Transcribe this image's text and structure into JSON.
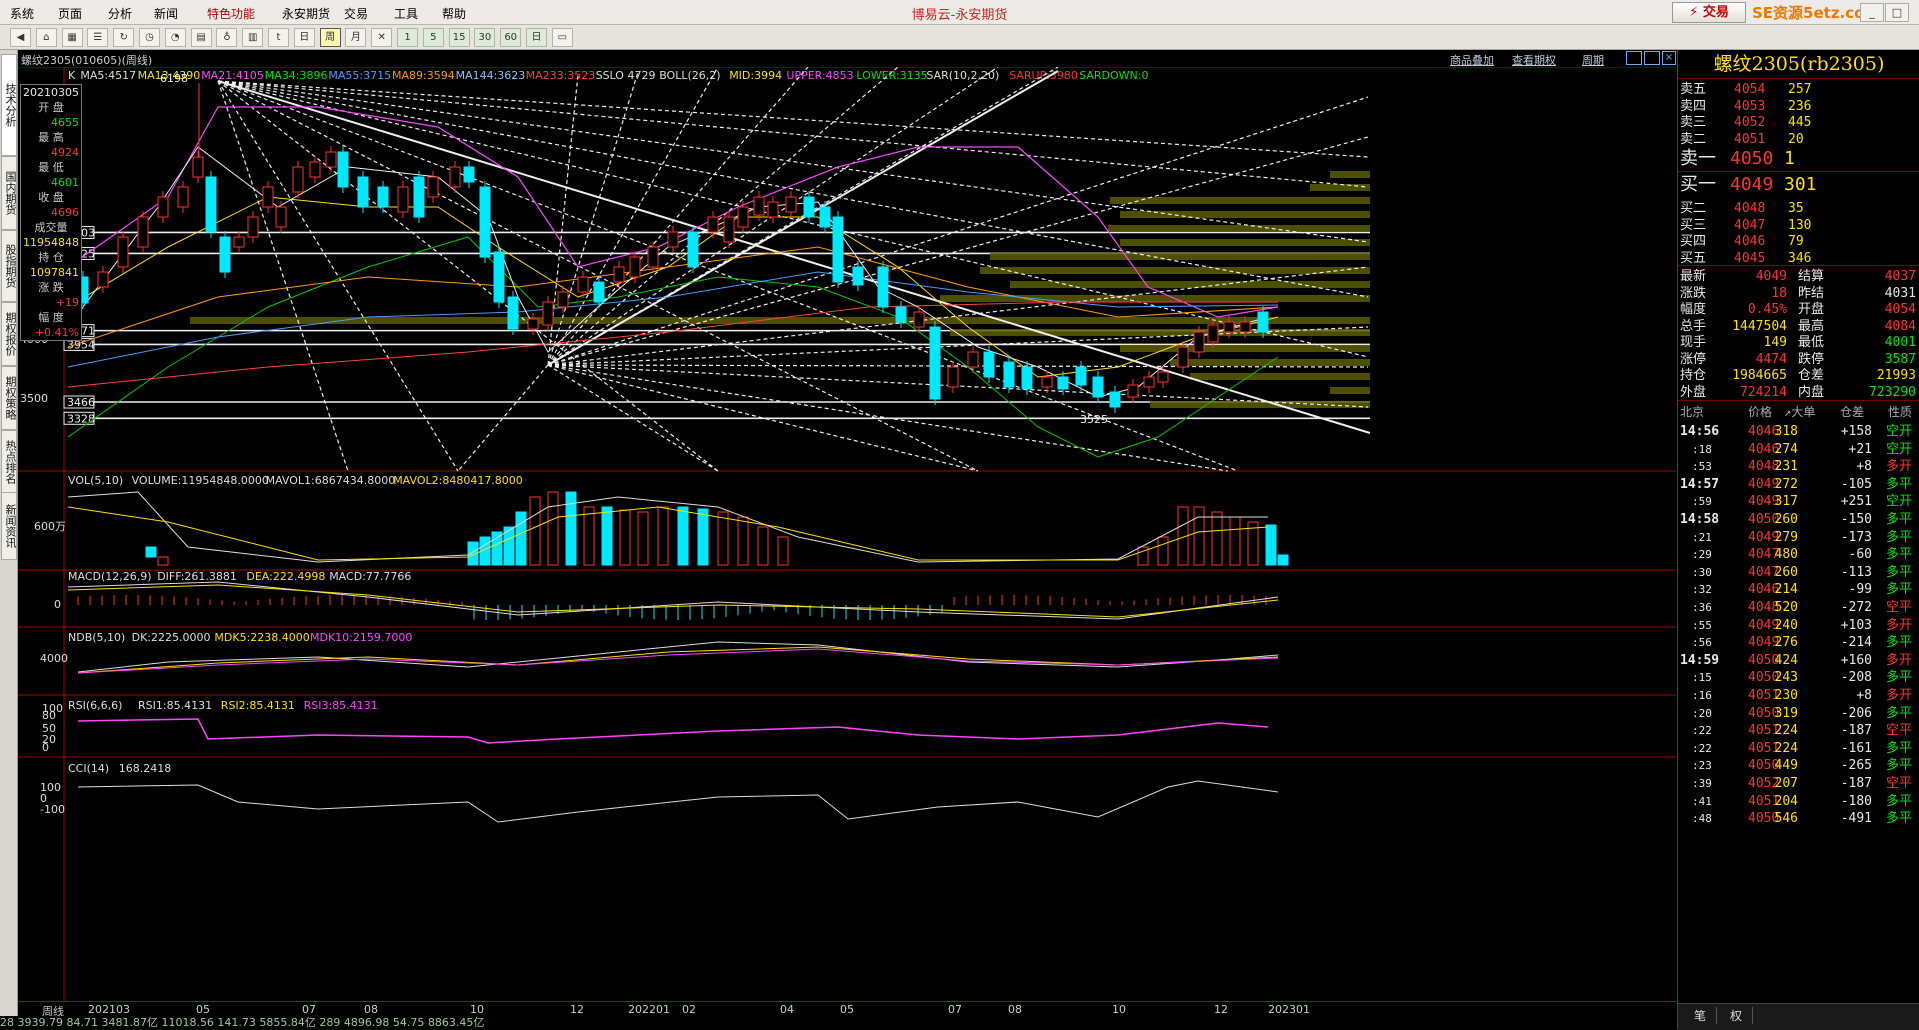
{
  "menu": {
    "items": [
      "系统",
      "页面",
      "分析",
      "新闻",
      "特色功能",
      "永安期货",
      "交易",
      "工具",
      "帮助"
    ],
    "highlight_index": 4,
    "app_title": "博易云-永安期货",
    "trade_button": "交易",
    "brand_watermark": "SE资源5etz.com"
  },
  "toolbar": {
    "period_buttons": [
      "1",
      "5",
      "15",
      "30",
      "60",
      "日"
    ],
    "icons": [
      "back-icon",
      "home-icon",
      "grid-icon",
      "list-icon",
      "refresh-icon",
      "clock-icon",
      "pie-icon",
      "chart-icon",
      "cup-icon",
      "bar-icon",
      "tick-icon",
      "day-icon",
      "week-icon",
      "month-icon",
      "x-icon",
      "num1",
      "num5",
      "num15",
      "num30",
      "num60",
      "day2",
      "print-icon"
    ]
  },
  "left_tabs": [
    "技术分析",
    "国内期货",
    "股指期货",
    "期权报价",
    "期权策略",
    "热点排名",
    "新闻资讯"
  ],
  "chart": {
    "symbol": "螺纹2305(010605)(周线)",
    "links": [
      "商品叠加",
      "查看期权",
      "周期"
    ],
    "ma_legend": [
      {
        "text": "K",
        "color": "#dddddd"
      },
      {
        "text": "MA5:4517",
        "color": "#dddddd"
      },
      {
        "text": "MA13:4390",
        "color": "#ffe000"
      },
      {
        "text": "MA21:4105",
        "color": "#ff44ff"
      },
      {
        "text": "MA34:3896",
        "color": "#00e600"
      },
      {
        "text": "MA55:3715",
        "color": "#4a9cff"
      },
      {
        "text": "MA89:3594",
        "color": "#ff9a00"
      },
      {
        "text": "MA144:3623",
        "color": "#7fc7ff"
      },
      {
        "text": "MA233:3523",
        "color": "#ff4040"
      },
      {
        "text": "SSLO 4729",
        "color": "#dddddd"
      },
      {
        "text": "BOLL(26,2)",
        "color": "#dddddd"
      },
      {
        "text": "MID:3994",
        "color": "#ffe000"
      },
      {
        "text": "UPPER:4853",
        "color": "#ff44ff"
      },
      {
        "text": "LOWER:3135",
        "color": "#00e600"
      },
      {
        "text": "SAR(10,2,20)",
        "color": "#dddddd"
      },
      {
        "text": "SARUP:3980",
        "color": "#ff3030"
      },
      {
        "text": "SARDOWN:0",
        "color": "#00e600"
      }
    ],
    "y_labels": [
      "4500",
      "4000",
      "3500"
    ],
    "y_boxes": [
      "4903",
      "4725",
      "4071",
      "3954",
      "3466",
      "3328"
    ],
    "peak_label": "6198",
    "low_label": "3525",
    "info": {
      "date": "20210305",
      "open_label": "开 盘",
      "open": "4655",
      "high_label": "最 高",
      "high": "4924",
      "low_label": "最 低",
      "low": "4601",
      "close_label": "收 盘",
      "close": "4696",
      "vol_label": "成交量",
      "vol": "11954848",
      "oi_label": "持 仓",
      "oi": "1097841",
      "chg_label": "涨 跌",
      "chg": "+19",
      "pct_label": "幅 度",
      "pct": "+0.41%"
    },
    "vol_legend": [
      {
        "text": "VOL(5,10)",
        "color": "#dddddd"
      },
      {
        "text": "VOLUME:11954848.0000",
        "color": "#dddddd"
      },
      {
        "text": "MAVOL1:6867434.8000",
        "color": "#dddddd"
      },
      {
        "text": "MAVOL2:8480417.8000",
        "color": "#ffe000"
      }
    ],
    "vol_y": "600万",
    "macd_legend": [
      {
        "text": "MACD(12,26,9)",
        "color": "#dddddd"
      },
      {
        "text": "DIFF:261.3881",
        "color": "#dddddd"
      },
      {
        "text": "DEA:222.4998",
        "color": "#ffe000"
      },
      {
        "text": "MACD:77.7766",
        "color": "#dddddd"
      }
    ],
    "macd_y": "0",
    "ndb_legend": [
      {
        "text": "NDB(5,10)",
        "color": "#dddddd"
      },
      {
        "text": "DK:2225.0000",
        "color": "#dddddd"
      },
      {
        "text": "MDK5:2238.4000",
        "color": "#ffe000"
      },
      {
        "text": "MDK10:2159.7000",
        "color": "#ff44ff"
      }
    ],
    "ndb_y": "4000",
    "rsi_legend": [
      {
        "text": "RSI(6,6,6)",
        "color": "#dddddd"
      },
      {
        "text": "RSI1:85.4131",
        "color": "#dddddd"
      },
      {
        "text": "RSI2:85.4131",
        "color": "#ffe000"
      },
      {
        "text": "RSI3:85.4131",
        "color": "#ff44ff"
      }
    ],
    "rsi_y": [
      "100",
      "80",
      "50",
      "20",
      "0"
    ],
    "cci_legend": [
      {
        "text": "CCI(14)",
        "color": "#dddddd"
      },
      {
        "text": "168.2418",
        "color": "#dddddd"
      }
    ],
    "cci_y": [
      "100",
      "0",
      "-100"
    ],
    "x_axis_label": "周线",
    "x_labels": [
      "202103",
      "05",
      "07",
      "08",
      "10",
      "12",
      "202201",
      "02",
      "04",
      "05",
      "07",
      "08",
      "10",
      "12",
      "202301"
    ],
    "status_text": "28  3939.79  84.71  3481.87亿  11018.56  141.73  5855.84亿  289  4896.98  54.75  8863.45亿"
  },
  "quote": {
    "title": "螺纹2305(rb2305)",
    "asks": [
      {
        "label": "卖五",
        "price": "4054",
        "vol": "257"
      },
      {
        "label": "卖四",
        "price": "4053",
        "vol": "236"
      },
      {
        "label": "卖三",
        "price": "4052",
        "vol": "445"
      },
      {
        "label": "卖二",
        "price": "4051",
        "vol": "20"
      },
      {
        "label": "卖一",
        "price": "4050",
        "vol": "1"
      }
    ],
    "bids": [
      {
        "label": "买一",
        "price": "4049",
        "vol": "301"
      },
      {
        "label": "买二",
        "price": "4048",
        "vol": "35"
      },
      {
        "label": "买三",
        "price": "4047",
        "vol": "130"
      },
      {
        "label": "买四",
        "price": "4046",
        "vol": "79"
      },
      {
        "label": "买五",
        "price": "4045",
        "vol": "346"
      }
    ],
    "stats": [
      {
        "l1": "最新",
        "v1": "4049",
        "c1": "red",
        "l2": "结算",
        "v2": "4037",
        "c2": "red"
      },
      {
        "l1": "涨跌",
        "v1": "18",
        "c1": "red",
        "l2": "昨结",
        "v2": "4031",
        "c2": "wht"
      },
      {
        "l1": "幅度",
        "v1": "0.45%",
        "c1": "red",
        "l2": "开盘",
        "v2": "4054",
        "c2": "red"
      },
      {
        "l1": "总手",
        "v1": "1447504",
        "c1": "yel",
        "l2": "最高",
        "v2": "4084",
        "c2": "red"
      },
      {
        "l1": "现手",
        "v1": "149",
        "c1": "yel",
        "l2": "最低",
        "v2": "4001",
        "c2": "green"
      },
      {
        "l1": "涨停",
        "v1": "4474",
        "c1": "red",
        "l2": "跌停",
        "v2": "3587",
        "c2": "green"
      },
      {
        "l1": "持仓",
        "v1": "1984665",
        "c1": "yel",
        "l2": "仓差",
        "v2": "21993",
        "c2": "yel"
      },
      {
        "l1": "外盘",
        "v1": "724214",
        "c1": "red",
        "l2": "内盘",
        "v2": "723290",
        "c2": "green"
      }
    ],
    "tick_header": {
      "time": "北京",
      "price": "价格",
      "vol": "↗大单",
      "diff": "仓差",
      "nature": "性质"
    },
    "ticks": [
      {
        "time": "14:56",
        "price": "4046",
        "pc": "red",
        "vol": "318",
        "diff": "+158",
        "nature": "空开",
        "nc": "green"
      },
      {
        "time": ":18",
        "price": "4046",
        "pc": "red",
        "vol": "274",
        "diff": "+21",
        "nature": "空开",
        "nc": "green"
      },
      {
        "time": ":53",
        "price": "4048",
        "pc": "red",
        "vol": "231",
        "diff": "+8",
        "nature": "多开",
        "nc": "red"
      },
      {
        "time": "14:57",
        "price": "4049",
        "pc": "red",
        "vol": "272",
        "diff": "-105",
        "nature": "多平",
        "nc": "green"
      },
      {
        "time": ":59",
        "price": "4049",
        "pc": "red",
        "vol": "317",
        "diff": "+251",
        "nature": "空开",
        "nc": "green"
      },
      {
        "time": "14:58",
        "price": "4050",
        "pc": "red",
        "vol": "260",
        "diff": "-150",
        "nature": "多平",
        "nc": "green"
      },
      {
        "time": ":21",
        "price": "4049",
        "pc": "red",
        "vol": "279",
        "diff": "-173",
        "nature": "多平",
        "nc": "green"
      },
      {
        "time": ":29",
        "price": "4047",
        "pc": "red",
        "vol": "480",
        "diff": "-60",
        "nature": "多平",
        "nc": "green"
      },
      {
        "time": ":30",
        "price": "4047",
        "pc": "red",
        "vol": "260",
        "diff": "-113",
        "nature": "多平",
        "nc": "green"
      },
      {
        "time": ":32",
        "price": "4046",
        "pc": "red",
        "vol": "214",
        "diff": "-99",
        "nature": "多平",
        "nc": "green"
      },
      {
        "time": ":36",
        "price": "4048",
        "pc": "red",
        "vol": "520",
        "diff": "-272",
        "nature": "空平",
        "nc": "red"
      },
      {
        "time": ":55",
        "price": "4049",
        "pc": "red",
        "vol": "240",
        "diff": "+103",
        "nature": "多开",
        "nc": "red"
      },
      {
        "time": ":56",
        "price": "4049",
        "pc": "red",
        "vol": "276",
        "diff": "-214",
        "nature": "多平",
        "nc": "green"
      },
      {
        "time": "14:59",
        "price": "4050",
        "pc": "red",
        "vol": "424",
        "diff": "+160",
        "nature": "多开",
        "nc": "red"
      },
      {
        "time": ":15",
        "price": "4050",
        "pc": "red",
        "vol": "243",
        "diff": "-208",
        "nature": "多平",
        "nc": "green"
      },
      {
        "time": ":16",
        "price": "4051",
        "pc": "red",
        "vol": "230",
        "diff": "+8",
        "nature": "多开",
        "nc": "red"
      },
      {
        "time": ":20",
        "price": "4050",
        "pc": "red",
        "vol": "319",
        "diff": "-206",
        "nature": "多平",
        "nc": "green"
      },
      {
        "time": ":22",
        "price": "4051",
        "pc": "red",
        "vol": "224",
        "diff": "-187",
        "nature": "空平",
        "nc": "red"
      },
      {
        "time": ":22",
        "price": "4051",
        "pc": "red",
        "vol": "224",
        "diff": "-161",
        "nature": "多平",
        "nc": "green"
      },
      {
        "time": ":23",
        "price": "4050",
        "pc": "red",
        "vol": "449",
        "diff": "-265",
        "nature": "多平",
        "nc": "green"
      },
      {
        "time": ":39",
        "price": "4052",
        "pc": "red",
        "vol": "207",
        "diff": "-187",
        "nature": "空平",
        "nc": "red"
      },
      {
        "time": ":41",
        "price": "4051",
        "pc": "red",
        "vol": "204",
        "diff": "-180",
        "nature": "多平",
        "nc": "green"
      },
      {
        "time": ":48",
        "price": "4050",
        "pc": "red",
        "vol": "546",
        "diff": "-491",
        "nature": "多平",
        "nc": "green"
      }
    ],
    "bottom_tabs": [
      "笔",
      "权"
    ]
  }
}
